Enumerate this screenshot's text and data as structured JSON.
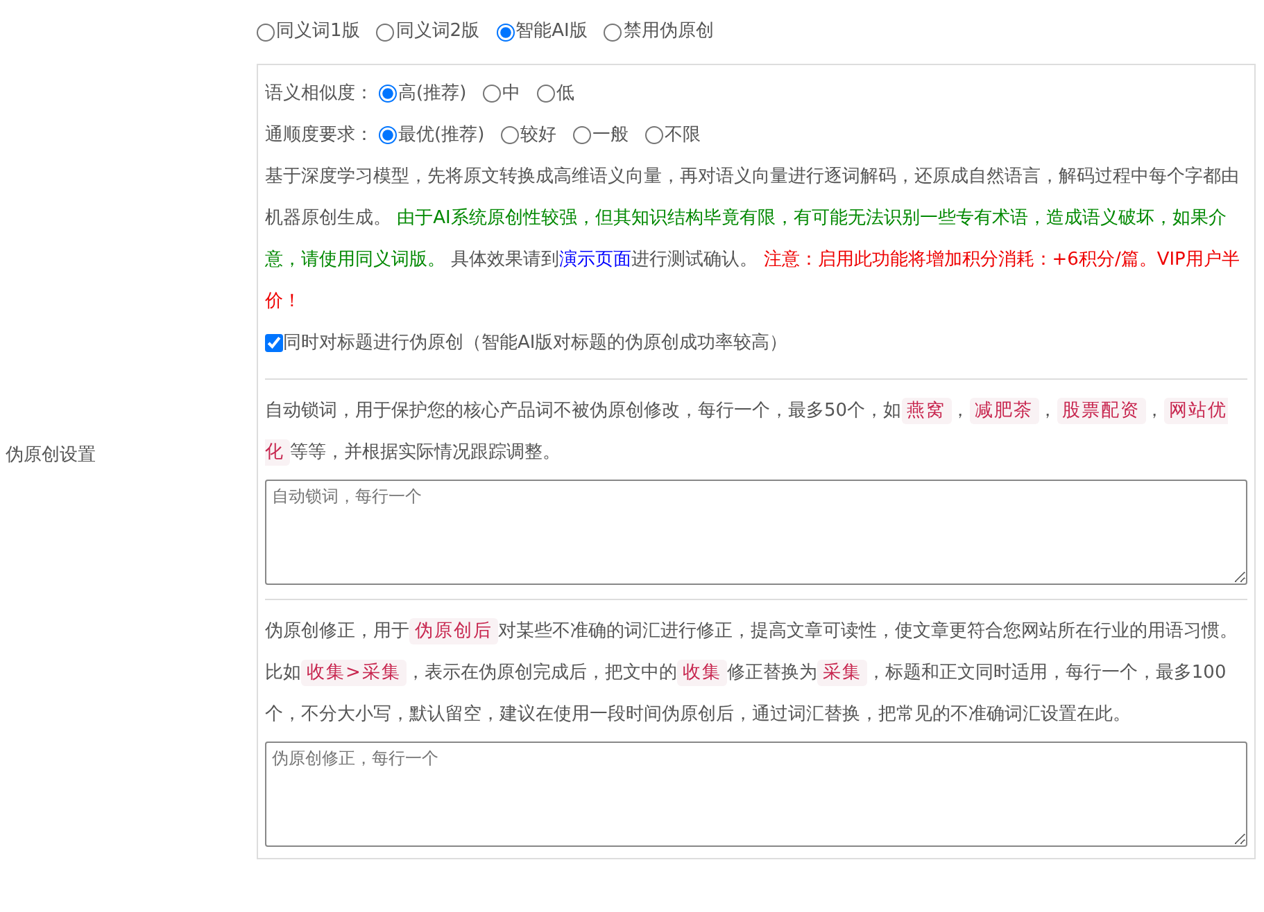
{
  "side_label": "伪原创设置",
  "mode_options": [
    {
      "label": "同义词1版",
      "selected": false
    },
    {
      "label": "同义词2版",
      "selected": false
    },
    {
      "label": "智能AI版",
      "selected": true
    },
    {
      "label": "禁用伪原创",
      "selected": false
    }
  ],
  "settings": [
    {
      "label": "语义相似度：",
      "options": [
        {
          "label": "高(推荐)",
          "selected": true
        },
        {
          "label": "中",
          "selected": false
        },
        {
          "label": "低",
          "selected": false
        }
      ]
    },
    {
      "label": "通顺度要求：",
      "options": [
        {
          "label": "最优(推荐)",
          "selected": true
        },
        {
          "label": "较好",
          "selected": false
        },
        {
          "label": "一般",
          "selected": false
        },
        {
          "label": "不限",
          "selected": false
        }
      ]
    }
  ],
  "description": [
    {
      "kind": "plain",
      "text": "基于深度学习模型，先将原文转换成高维语义向量，再对语义向量进行逐词解码，还原成自然语言，解码过程中每个字都由机器原创生成。 "
    },
    {
      "kind": "success",
      "text": "由于AI系统原创性较强，但其知识结构毕竟有限，有可能无法识别一些专有术语，造成语义破坏，如果介意，请使用同义词版。"
    },
    {
      "kind": "plain",
      "text": " 具体效果请到"
    },
    {
      "kind": "link",
      "text": "演示页面"
    },
    {
      "kind": "plain",
      "text": "进行测试确认。 "
    },
    {
      "kind": "danger",
      "text": "注意：启用此功能将增加积分消耗：+6积分/篇。VIP用户半价！"
    }
  ],
  "title_checkbox": {
    "label": "同时对标题进行伪原创（智能AI版对标题的伪原创成功率较高）",
    "checked": true
  },
  "sections": [
    {
      "description": [
        {
          "kind": "plain",
          "text": "自动锁词，用于保护您的核心产品词不被伪原创修改，每行一个，最多50个，如"
        },
        {
          "kind": "tag",
          "text": "燕窝"
        },
        {
          "kind": "plain",
          "text": "，"
        },
        {
          "kind": "tag",
          "text": "减肥茶"
        },
        {
          "kind": "plain",
          "text": "，"
        },
        {
          "kind": "tag",
          "text": "股票配资"
        },
        {
          "kind": "plain",
          "text": "，"
        },
        {
          "kind": "tag",
          "text": "网站优化"
        },
        {
          "kind": "plain",
          "text": "等等，并根据实际情况跟踪调整。"
        }
      ],
      "placeholder": "自动锁词，每行一个"
    },
    {
      "description": [
        {
          "kind": "plain",
          "text": "伪原创修正，用于"
        },
        {
          "kind": "tag",
          "text": "伪原创后"
        },
        {
          "kind": "plain",
          "text": "对某些不准确的词汇进行修正，提高文章可读性，使文章更符合您网站所在行业的用语习惯。比如"
        },
        {
          "kind": "tag",
          "text": "收集>采集"
        },
        {
          "kind": "plain",
          "text": "，表示在伪原创完成后，把文中的"
        },
        {
          "kind": "tag",
          "text": "收集"
        },
        {
          "kind": "plain",
          "text": "修正替换为"
        },
        {
          "kind": "tag",
          "text": "采集"
        },
        {
          "kind": "plain",
          "text": "，标题和正文同时适用，每行一个，最多100个，不分大小写，默认留空，建议在使用一段时间伪原创后，通过词汇替换，把常见的不准确词汇设置在此。"
        }
      ],
      "placeholder": "伪原创修正，每行一个"
    }
  ]
}
